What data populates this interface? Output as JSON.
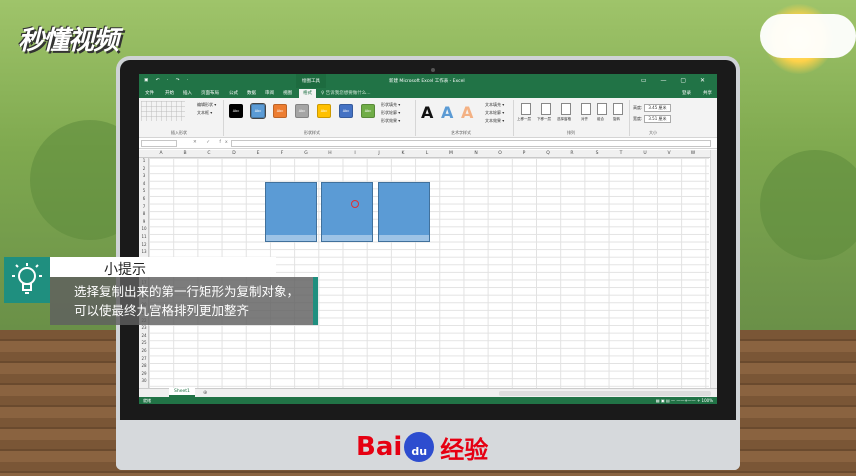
{
  "logo": "秒懂视频",
  "excel": {
    "quick_access": "▣ ↶ · ↷ ·",
    "context_tab": "绘图工具",
    "doc_title": "新建 Microsoft Excel 工作表 - Excel",
    "window_buttons": "▭ — ▢ ✕",
    "tabs": [
      "文件",
      "开始",
      "插入",
      "页面布局",
      "公式",
      "数据",
      "审阅",
      "视图",
      "格式"
    ],
    "active_tab": "格式",
    "tell_me": "♀ 告诉我您想要做什么...",
    "login": "登录",
    "share": "共享",
    "ribbon": {
      "edit_shape": "编辑形状 ▾",
      "text_box": "文本框 ▾",
      "group_insert_shapes": "插入形状",
      "style_label": "Abc",
      "shape_fill": "形状填充 ▾",
      "shape_outline": "形状轮廓 ▾",
      "shape_effects": "形状效果 ▾",
      "group_shape_styles": "形状样式",
      "wordart_letter": "A",
      "text_fill": "文本填充 ▾",
      "text_outline": "文本轮廓 ▾",
      "text_effects": "文本效果 ▾",
      "group_wordart": "艺术字样式",
      "bring_forward": "上移一层",
      "send_backward": "下移一层",
      "selection_pane": "选择窗格",
      "align": "对齐",
      "group": "组合",
      "rotate": "旋转",
      "group_arrange": "排列",
      "height_label": "高度:",
      "height_value": "3.45 厘米",
      "width_label": "宽度:",
      "width_value": "3.51 厘米",
      "group_size": "大小"
    },
    "fx_label": "✕ ✓ fx",
    "columns": [
      "A",
      "B",
      "C",
      "D",
      "E",
      "F",
      "G",
      "H",
      "I",
      "J",
      "K",
      "L",
      "M",
      "N",
      "O",
      "P",
      "Q",
      "R",
      "S",
      "T",
      "U",
      "V",
      "W"
    ],
    "rows": [
      "1",
      "2",
      "3",
      "4",
      "5",
      "6",
      "7",
      "8",
      "9",
      "10",
      "11",
      "12",
      "13",
      "14",
      "15",
      "16",
      "17",
      "18",
      "19",
      "20",
      "21",
      "22",
      "23",
      "24",
      "25",
      "26",
      "27",
      "28",
      "29",
      "30",
      "31"
    ],
    "sheet_tab": "Sheet1",
    "add_sheet": "⊕",
    "status_ready": "就绪",
    "zoom": "▦ ▣ ▤ — ——+—— + 100%"
  },
  "tip": {
    "title": "小提示",
    "body": "选择复制出来的第一行矩形为复制对象，可以使最终九宫格排列更加整齐"
  },
  "baidu": {
    "brand": "Bai",
    "paw_text": "du",
    "suffix": "经验"
  },
  "colors": {
    "excel_green": "#217346",
    "shape_fill": "#5b9bd5",
    "tip_teal": "#1f8f7f",
    "baidu_red": "#e60012",
    "baidu_blue": "#2d4dcf"
  }
}
